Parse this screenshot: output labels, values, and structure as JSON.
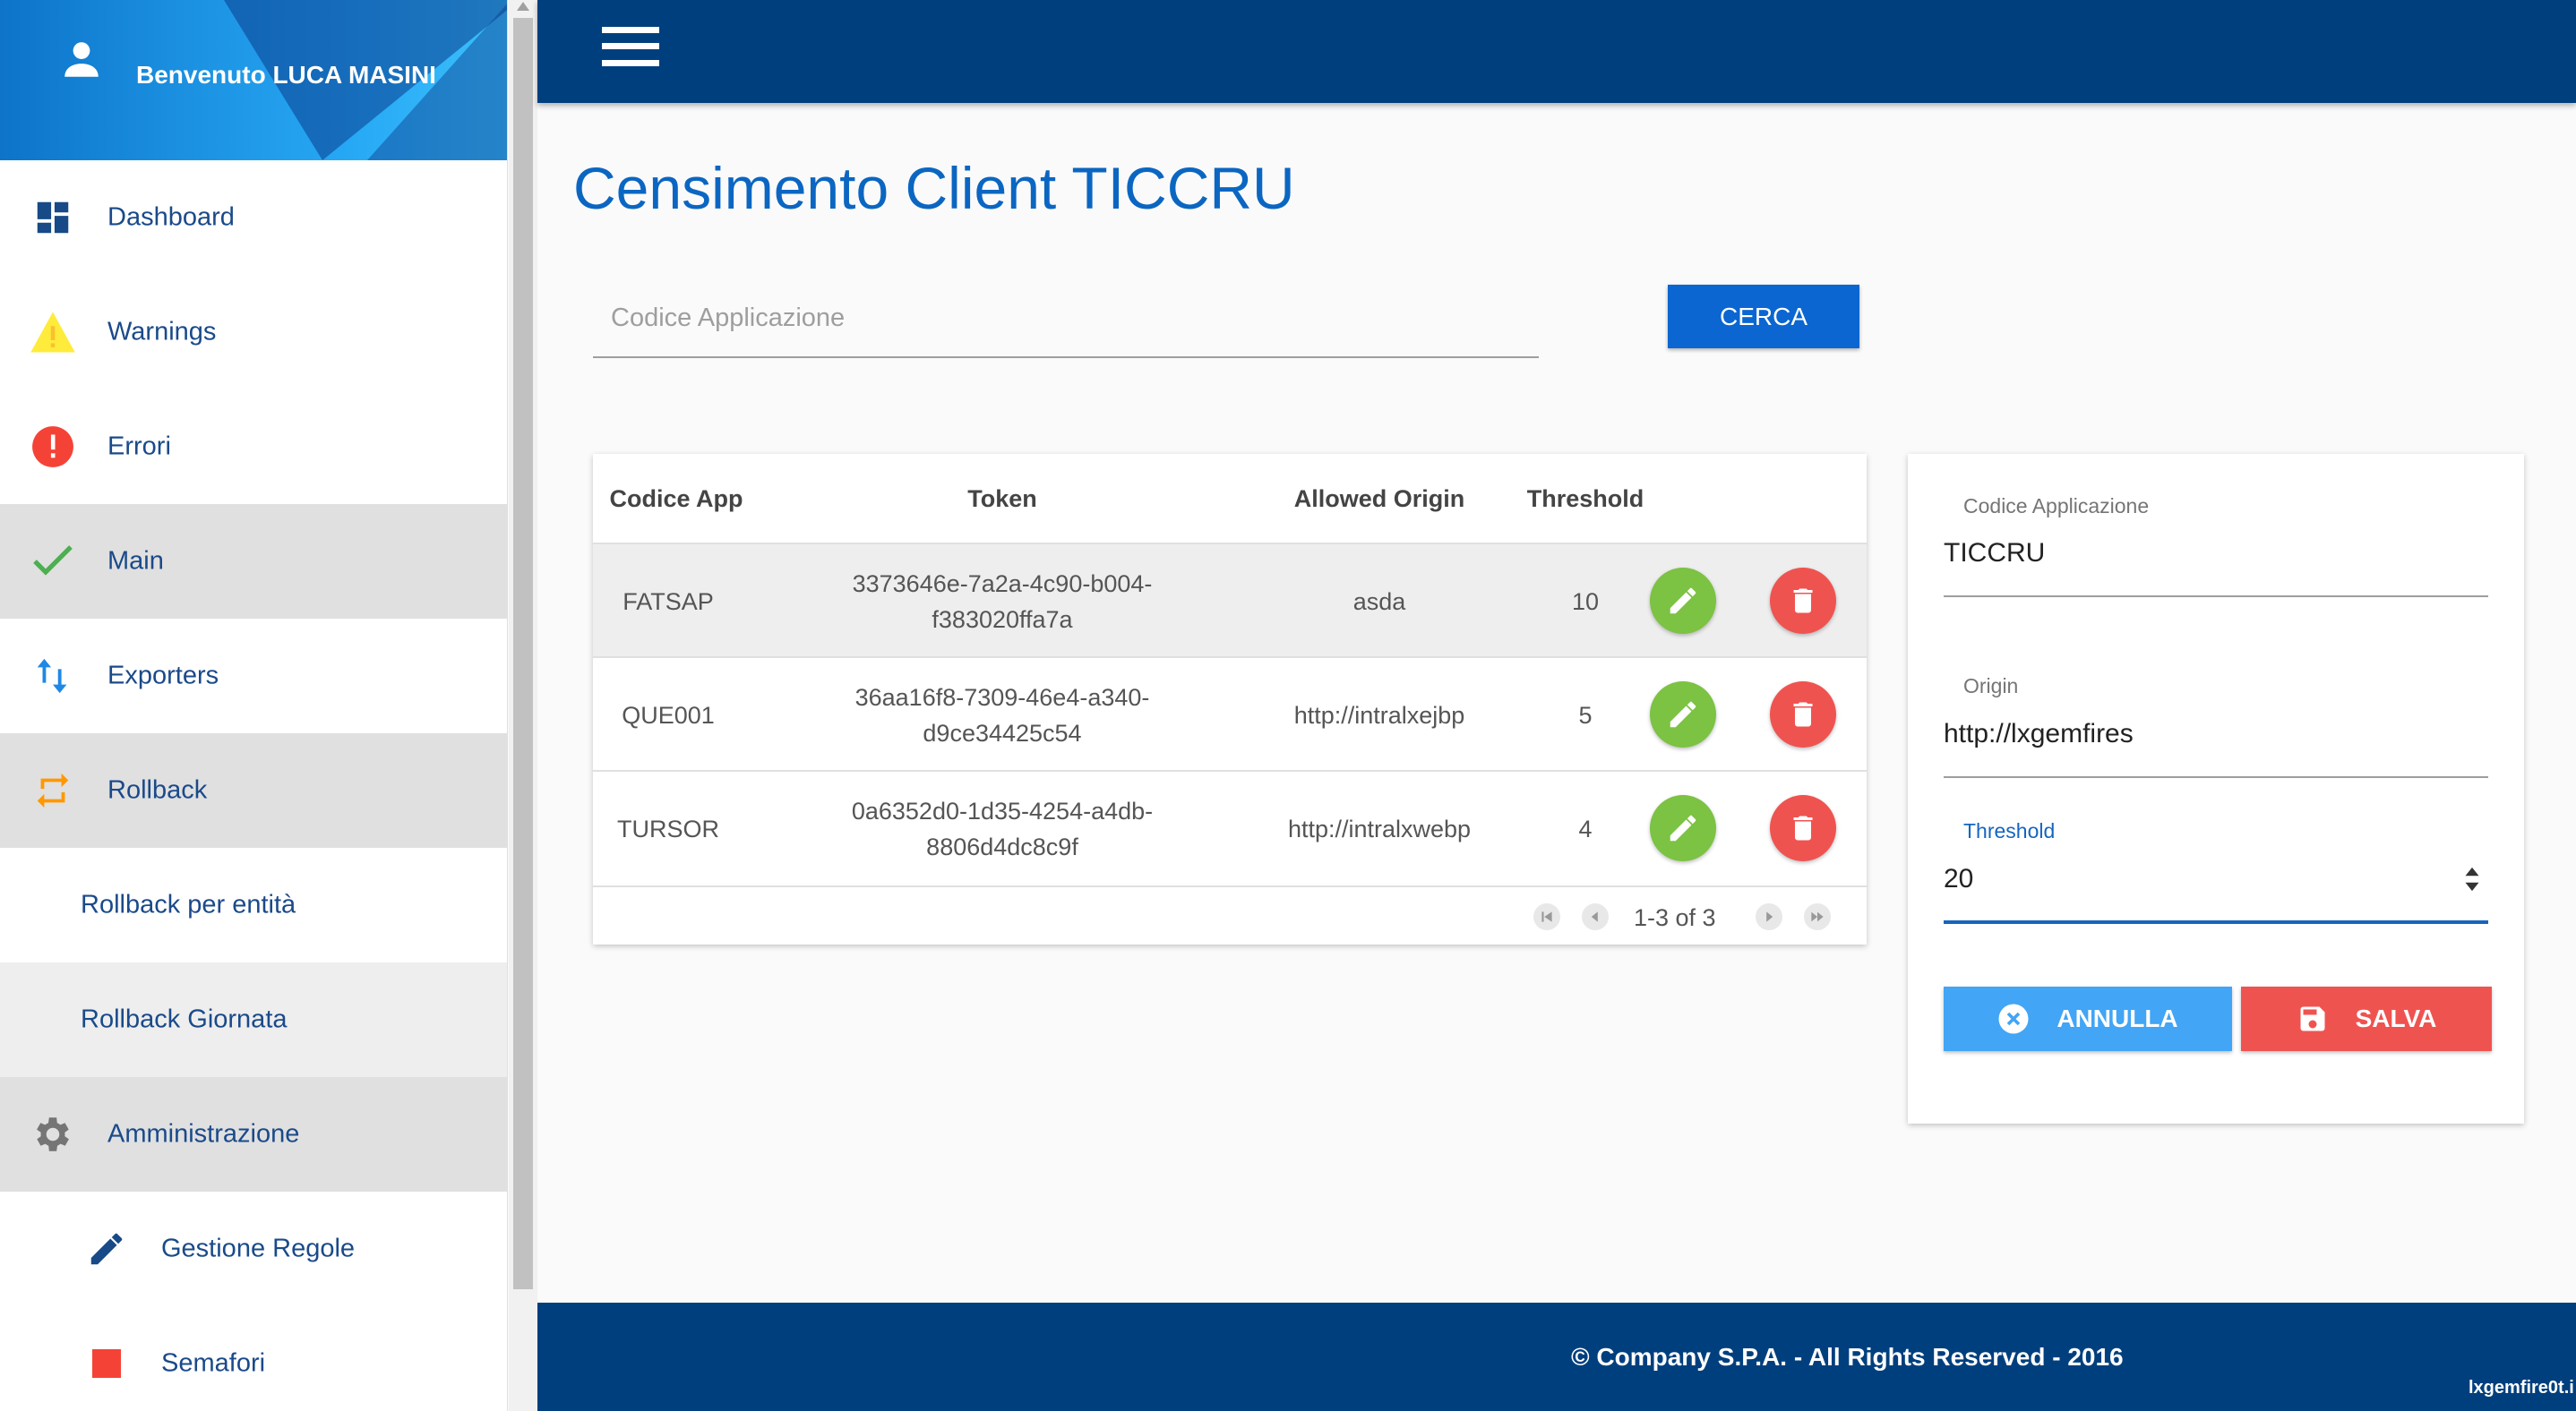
{
  "sidebar": {
    "welcome": "Benvenuto LUCA MASINI",
    "items": [
      {
        "label": "Dashboard",
        "icon": "dashboard-icon"
      },
      {
        "label": "Warnings",
        "icon": "warning-icon"
      },
      {
        "label": "Errori",
        "icon": "error-icon"
      },
      {
        "label": "Main",
        "icon": "check-icon"
      },
      {
        "label": "Exporters",
        "icon": "swap-vertical-icon"
      },
      {
        "label": "Rollback",
        "icon": "repeat-icon"
      },
      {
        "label": "Rollback per entità"
      },
      {
        "label": "Rollback Giornata"
      },
      {
        "label": "Amministrazione",
        "icon": "gear-icon"
      },
      {
        "label": "Gestione Regole",
        "icon": "pencil-icon"
      },
      {
        "label": "Semafori",
        "icon": "red-square-icon"
      }
    ]
  },
  "page": {
    "title": "Censimento Client TICCRU"
  },
  "search": {
    "placeholder": "Codice Applicazione",
    "value": "",
    "button_label": "CERCA"
  },
  "table": {
    "headers": [
      "Codice App",
      "Token",
      "Allowed Origin",
      "Threshold"
    ],
    "rows": [
      {
        "code": "FATSAP",
        "token_line1": "3373646e-7a2a-4c90-b004-",
        "token_line2": "f383020ffa7a",
        "origin": "asda",
        "threshold": "10"
      },
      {
        "code": "QUE001",
        "token_line1": "36aa16f8-7309-46e4-a340-",
        "token_line2": "d9ce34425c54",
        "origin": "http://intralxejbp",
        "threshold": "5"
      },
      {
        "code": "TURSOR",
        "token_line1": "0a6352d0-1d35-4254-a4db-",
        "token_line2": "8806d4dc8c9f",
        "origin": "http://intralxwebp",
        "threshold": "4"
      }
    ],
    "pagination": "1-3 of 3"
  },
  "form": {
    "code_label": "Codice Applicazione",
    "code_value": "TICCRU",
    "origin_label": "Origin",
    "origin_value": "http://lxgemfires",
    "threshold_label": "Threshold",
    "threshold_value": "20",
    "cancel_label": "ANNULLA",
    "save_label": "SALVA"
  },
  "footer": {
    "copyright": "© Company S.P.A. - All Rights Reserved - 2016",
    "host": "lxgemfire0t.i"
  },
  "colors": {
    "brand_dark": "#003f7d",
    "primary": "#0b66d1",
    "edit": "#7cc243",
    "delete": "#ef5350",
    "cancel": "#42a5f5"
  }
}
